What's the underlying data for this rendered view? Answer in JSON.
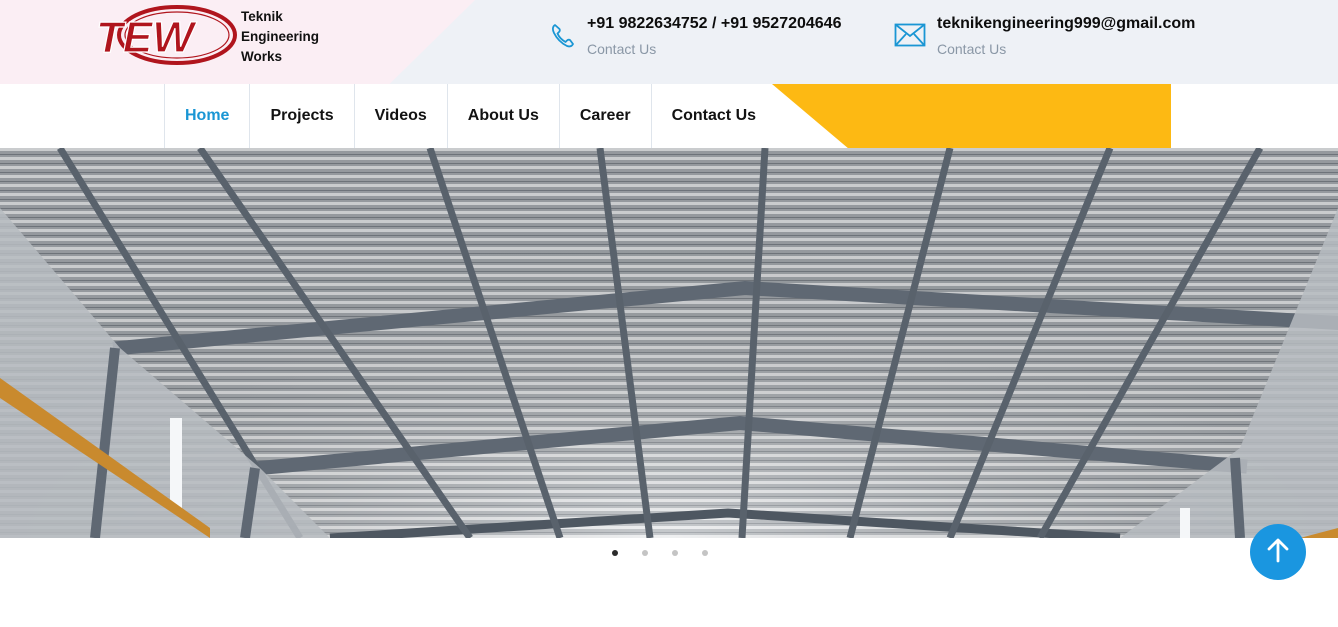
{
  "brand": {
    "logo_text": "TEW",
    "name_lines": [
      "Teknik",
      "Engineering",
      "Works"
    ]
  },
  "contacts": {
    "phone": {
      "icon": "phone-icon",
      "value": "+91 9822634752 / +91 9527204646",
      "label": "Contact Us"
    },
    "email": {
      "icon": "mail-icon",
      "value": "teknikengineering999@gmail.com",
      "label": "Contact Us"
    }
  },
  "nav": {
    "items": [
      {
        "label": "Home",
        "active": true
      },
      {
        "label": "Projects",
        "active": false
      },
      {
        "label": "Videos",
        "active": false
      },
      {
        "label": "About Us",
        "active": false
      },
      {
        "label": "Career",
        "active": false
      },
      {
        "label": "Contact Us",
        "active": false
      }
    ]
  },
  "slider": {
    "slide_count": 4,
    "active_index": 0,
    "image": "steel-roof-interior-photo"
  },
  "scroll_top": {
    "icon": "arrow-up-icon"
  },
  "colors": {
    "accent_blue": "#1a96d4",
    "accent_yellow": "#fdb913",
    "logo_red": "#b0151d",
    "topbar_bg": "#eef1f6",
    "topbar_pink": "#fbeef4"
  }
}
